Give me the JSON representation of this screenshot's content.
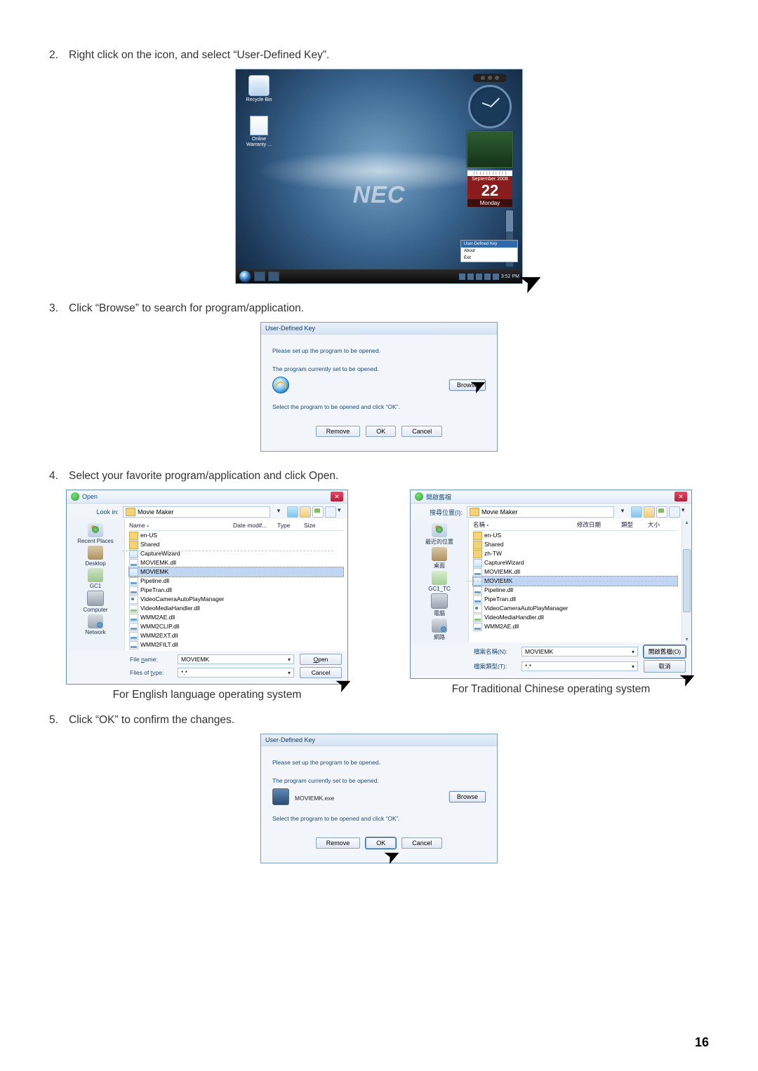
{
  "page_number": "16",
  "steps": {
    "s2": {
      "num": "2.",
      "text": "Right click on the icon, and select “User-Defined Key”."
    },
    "s3": {
      "num": "3.",
      "text": "Click “Browse” to search for program/application."
    },
    "s4": {
      "num": "4.",
      "text": "Select your favorite program/application and click Open."
    },
    "s5": {
      "num": "5.",
      "text": "Click “OK” to confirm the changes."
    }
  },
  "captions": {
    "en": "For English language operating system",
    "tc": "For Traditional Chinese operating system"
  },
  "desktop": {
    "brand": "NEC",
    "recycle": "Recycle Bin",
    "warranty": "Online Warranty ...",
    "context": {
      "udk": "User-Defined Key",
      "about": "About",
      "exit": "Exit"
    },
    "calendar": {
      "month": "September 2008",
      "date": "22",
      "day": "Monday"
    },
    "taskbar_time": "3:52 PM"
  },
  "udk": {
    "title": "User-Defined Key",
    "line1": "Please set up the program to be opened.",
    "line2": "The program currently set to be opened.",
    "line3": "Select the program to be opened and click “OK”.",
    "prog": "MOVIEMK.exe",
    "browse": "Browse",
    "remove": "Remove",
    "ok": "OK",
    "cancel": "Cancel"
  },
  "open_en": {
    "title": "Open",
    "lookin": "Look in:",
    "path": "Movie Maker",
    "headers": {
      "name": "Name",
      "date": "Date modif...",
      "type": "Type",
      "size": "Size"
    },
    "files": [
      "en-US",
      "Shared",
      "CaptureWizard",
      "MOVIEMK.dll",
      "MOVIEMK",
      "Pipeline.dll",
      "PipeTran.dll",
      "VideoCameraAutoPlayManager",
      "VideoMediaHandler.dll",
      "WMM2AE.dll",
      "WMM2CLIP.dll",
      "WMM2EXT.dll",
      "WMM2FILT.dll"
    ],
    "sidebar": [
      "Recent Places",
      "Desktop",
      "GC1",
      "Computer",
      "Network"
    ],
    "filename_lbl": "File name:",
    "filetype_lbl": "Files of type:",
    "filename_val": "MOVIEMK",
    "filetype_val": "*.*",
    "open_btn": "Open",
    "cancel_btn": "Cancel"
  },
  "open_tc": {
    "title": "開啟舊檔",
    "lookin": "搜尋位置(I):",
    "path": "Movie Maker",
    "headers": {
      "name": "名稱",
      "date": "修改日期",
      "type": "類型",
      "size": "大小"
    },
    "files": [
      "en-US",
      "Shared",
      "zh-TW",
      "CaptureWizard",
      "MOVIEMK.dll",
      "MOVIEMK",
      "Pipeline.dll",
      "PipeTran.dll",
      "VideoCameraAutoPlayManager",
      "VideoMediaHandler.dll",
      "WMM2AE.dll"
    ],
    "sidebar": [
      "最近的位置",
      "桌面",
      "GC1_TC",
      "電腦",
      "網路"
    ],
    "filename_lbl": "檔案名稱(N):",
    "filetype_lbl": "檔案類型(T):",
    "filename_val": "MOVIEMK",
    "filetype_val": "*.*",
    "open_btn": "開啟舊檔(O)",
    "cancel_btn": "取消"
  }
}
